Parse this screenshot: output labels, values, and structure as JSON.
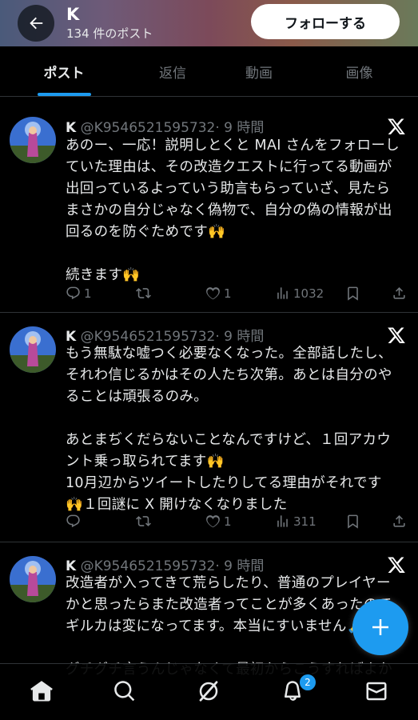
{
  "header": {
    "name": "K",
    "post_count": "134 件のポスト",
    "follow_label": "フォローする"
  },
  "tabs": [
    {
      "label": "ポスト",
      "active": true
    },
    {
      "label": "返信",
      "active": false
    },
    {
      "label": "動画",
      "active": false
    },
    {
      "label": "画像",
      "active": false
    }
  ],
  "posts": [
    {
      "name": "K",
      "handle": "@K9546521595732",
      "time": "· 9 時間",
      "text": "あのー、一応！説明しとくと MAI さんをフォローし\nていた理由は、その改造クエストに行ってる動画が\n出回っているよっていう助言もらっていざ、見たら\nまさかの自分じゃなく偽物で、自分の偽の情報が出\n回るのを防ぐためです🙌\n\n続きます🙌",
      "replies": "1",
      "reposts": "",
      "likes": "1",
      "views": "1032"
    },
    {
      "name": "K",
      "handle": "@K9546521595732",
      "time": "· 9 時間",
      "text": "もう無駄な嘘つく必要なくなった。全部話したし、\nそれわ信じるかはその人たち次第。あとは自分のや\nることは頑張るのみ。\n\nあとまぢくだらないことなんですけど、１回アカウ\nント乗っ取られてます🙌\n10月辺からツイートしたりしてる理由がそれです\n🙌１回謎に X 開けなくなりました",
      "replies": "",
      "reposts": "",
      "likes": "1",
      "views": "311"
    },
    {
      "name": "K",
      "handle": "@K9546521595732",
      "time": "· 9 時間",
      "text": "改造者が入ってきて荒らしたり、普通のプレイヤー\nかと思ったらまた改造者ってことが多くあったので\nギルカは変になってます。本当にすいません🙏\n\nグチグチ言うんじゃなくて最初からこうすればよか",
      "replies": "",
      "reposts": "",
      "likes": "",
      "views": ""
    }
  ],
  "bottom_nav": {
    "notification_badge": "2",
    "items": [
      "home-icon",
      "search-icon",
      "grok-icon",
      "notifications-icon",
      "messages-icon"
    ]
  },
  "colors": {
    "accent": "#1d9bf0",
    "background": "#000000",
    "muted": "#71767b",
    "text": "#e7e9ea"
  }
}
